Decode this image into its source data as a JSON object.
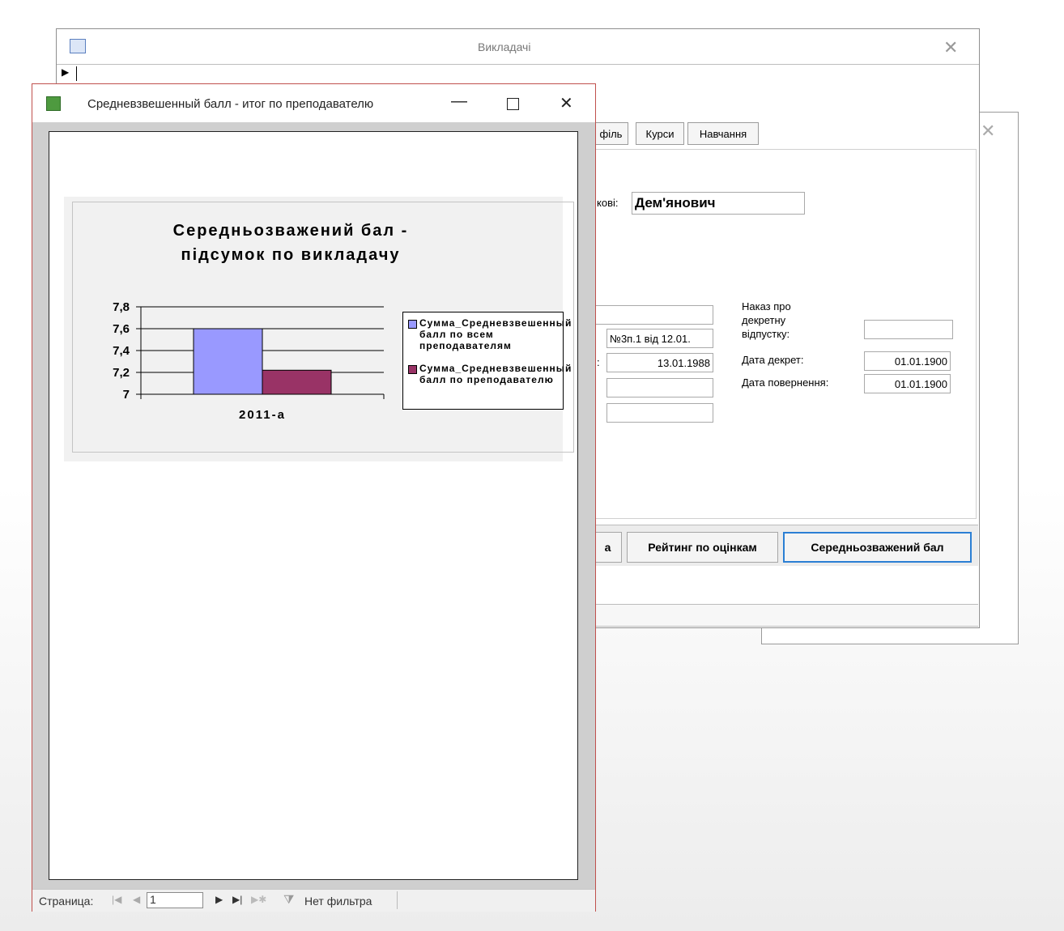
{
  "back_window": {
    "title": "Викладачі",
    "tabs": [
      "філь",
      "Курси",
      "Навчання"
    ],
    "name_label": "кові:",
    "name_value": "Дем'янович",
    "fields": {
      "order_value": "№3п.1 від 12.01.",
      "date_label_fragment": ":",
      "date_value": "13.01.1988"
    },
    "maternity": {
      "order_label": "Наказ про декретну відпустку:",
      "decree_date_label": "Дата декрет:",
      "decree_date_value": "01.01.1900",
      "return_date_label": "Дата повернення:",
      "return_date_value": "01.01.1900"
    },
    "buttons": [
      "а",
      "Рейтинг по оцінкам",
      "Середньозважений бал"
    ]
  },
  "front_window": {
    "title": "Средневзвешенный балл - итог по преподавателю",
    "statusbar": {
      "page_label": "Страница:",
      "page_value": "1",
      "filter_label": "Нет фильтра"
    }
  },
  "chart_data": {
    "type": "bar",
    "title": "Середньозважений бал - підсумок по викладачу",
    "categories": [
      "2011-а"
    ],
    "series": [
      {
        "name": "Сумма_Средневзвешенный балл по всем преподавателям",
        "values": [
          7.6
        ],
        "color": "#9999ff"
      },
      {
        "name": "Сумма_Средневзвешенный балл по преподавателю",
        "values": [
          7.22
        ],
        "color": "#993366"
      }
    ],
    "ylim": [
      7,
      7.8
    ],
    "yticks": [
      "7,8",
      "7,6",
      "7,4",
      "7,2",
      "7"
    ],
    "grid": true,
    "legend": "right"
  }
}
